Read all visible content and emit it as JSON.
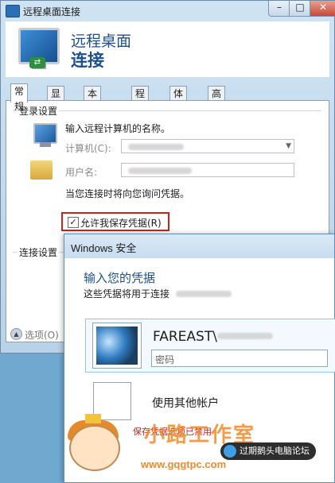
{
  "window": {
    "title": "远程桌面连接",
    "banner_line1": "远程桌面",
    "banner_line2": "连接",
    "controls": {
      "minimize": "–",
      "maximize": "□",
      "close": "✕"
    }
  },
  "tabs": [
    {
      "label": "常规",
      "active": true
    },
    {
      "label": "显示"
    },
    {
      "label": "本地资源"
    },
    {
      "label": "程序"
    },
    {
      "label": "体验"
    },
    {
      "label": "高级"
    }
  ],
  "login": {
    "group_label": "登录设置",
    "prompt": "输入远程计算机的名称。",
    "computer_label": "计算机(C):",
    "user_label": "用户名:",
    "ask_note": "当您连接时将向您询问凭据。",
    "allow_save_label": "允许我保存凭据(R)",
    "allow_save_checked": true
  },
  "connection": {
    "group_label": "连接设置"
  },
  "options_label": "选项(O)",
  "security": {
    "title": "Windows 安全",
    "heading": "输入您的凭据",
    "subtitle": "这些凭据将用于连接",
    "user_prefix": "FAREAST\\",
    "password_placeholder": "密码",
    "other_account": "使用其他帐户",
    "remember_text": "保存凭据选项已禁用"
  },
  "watermark": {
    "brand": "小路工作室",
    "url": "www.gqgtpc.com",
    "forum": "过期鹅头电脑论坛"
  },
  "icons": {
    "app": "remote-desktop-icon",
    "computer": "computer-icon",
    "folder": "folder-icon",
    "options": "chevron-up-icon"
  },
  "colors": {
    "accent": "#1f4f8a",
    "highlight": "#c8231f",
    "watermark": "#f08a2b"
  }
}
